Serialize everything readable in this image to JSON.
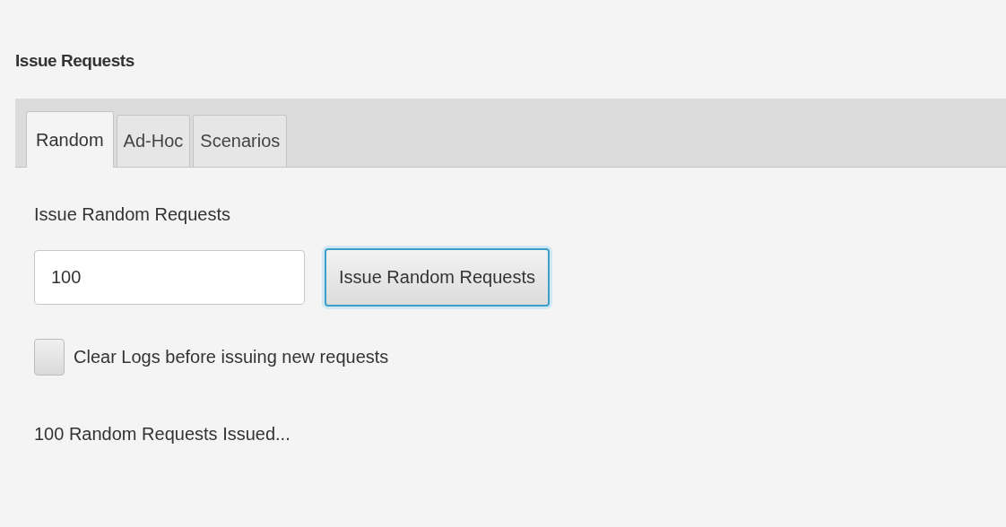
{
  "title": "Issue Requests",
  "tabs": [
    {
      "label": "Random",
      "selected": true
    },
    {
      "label": "Ad-Hoc",
      "selected": false
    },
    {
      "label": "Scenarios",
      "selected": false
    }
  ],
  "section_label": "Issue Random Requests",
  "count_field": {
    "value": "100"
  },
  "issue_button": {
    "label": "Issue Random Requests",
    "focused": true
  },
  "clear_logs": {
    "label": "Clear Logs before issuing new requests",
    "checked": false
  },
  "status": "100 Random Requests Issued..."
}
